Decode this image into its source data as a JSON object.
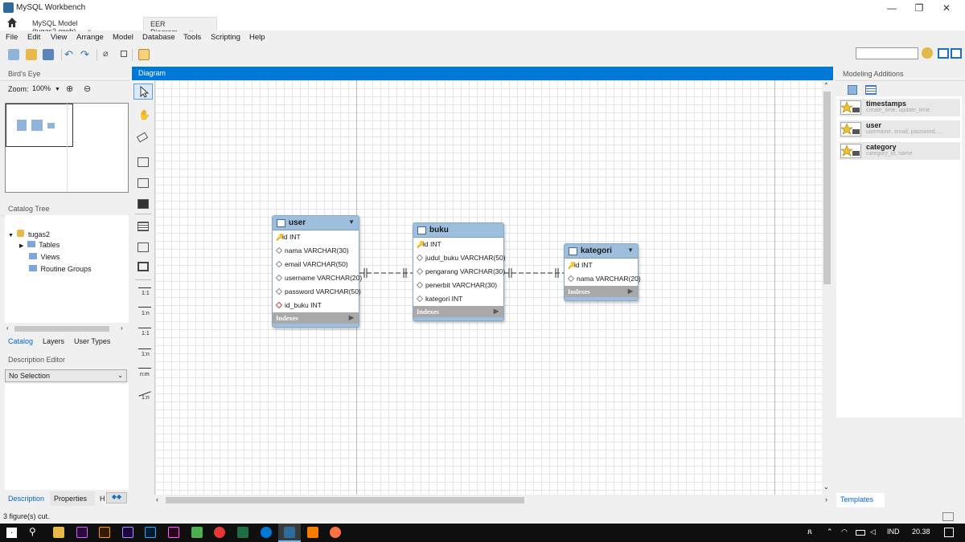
{
  "window": {
    "title": "MySQL Workbench",
    "controls": {
      "minimize": "—",
      "restore": "❐",
      "close": "✕"
    }
  },
  "tabs": [
    {
      "label": "MySQL Model (tugas2.mwb)",
      "close": "×"
    },
    {
      "label": "EER Diagram",
      "close": "×"
    }
  ],
  "menu": [
    "File",
    "Edit",
    "View",
    "Arrange",
    "Model",
    "Database",
    "Tools",
    "Scripting",
    "Help"
  ],
  "left": {
    "birdseye_title": "Bird's Eye",
    "zoom_label": "Zoom:",
    "zoom_value": "100%",
    "catalog_title": "Catalog Tree",
    "tree": {
      "root": "tugas2",
      "children": [
        "Tables",
        "Views",
        "Routine Groups"
      ]
    },
    "tabs": [
      "Catalog",
      "Layers",
      "User Types"
    ],
    "desc_title": "Description Editor",
    "desc_select": "No Selection",
    "bottom_tabs": [
      "Description",
      "Properties",
      "H"
    ]
  },
  "diagram": {
    "header": "Diagram",
    "entities": [
      {
        "name": "user",
        "columns": [
          {
            "text": "id INT",
            "kind": "pk"
          },
          {
            "text": "nama VARCHAR(30)",
            "kind": "col"
          },
          {
            "text": "email VARCHAR(50)",
            "kind": "col"
          },
          {
            "text": "username VARCHAR(20)",
            "kind": "col"
          },
          {
            "text": "password VARCHAR(50)",
            "kind": "col"
          },
          {
            "text": "id_buku INT",
            "kind": "fk"
          }
        ],
        "indexes": "Indexes"
      },
      {
        "name": "buku",
        "columns": [
          {
            "text": "id INT",
            "kind": "pk"
          },
          {
            "text": "judul_buku VARCHAR(50)",
            "kind": "col"
          },
          {
            "text": "pengarang VARCHAR(30)",
            "kind": "col"
          },
          {
            "text": "penerbit VARCHAR(30)",
            "kind": "col"
          },
          {
            "text": "kategori INT",
            "kind": "col"
          }
        ],
        "indexes": "Indexes"
      },
      {
        "name": "kategori",
        "columns": [
          {
            "text": "id INT",
            "kind": "pk"
          },
          {
            "text": "nama VARCHAR(20)",
            "kind": "col"
          }
        ],
        "indexes": "Indexes"
      }
    ]
  },
  "tools": {
    "labels": [
      "1:1",
      "1:n",
      "1:1",
      "1:n",
      "n:m",
      "1:n"
    ]
  },
  "right": {
    "title": "Modeling Additions",
    "templates": [
      {
        "name": "timestamps",
        "sub": "create_time, update_time"
      },
      {
        "name": "user",
        "sub": "username, email, password, ..."
      },
      {
        "name": "category",
        "sub": "category_id, name"
      }
    ],
    "bottom_tab": "Templates"
  },
  "status": "3 figure(s) cut.",
  "taskbar": {
    "lang": "IND",
    "time": "20.38"
  },
  "colors": {
    "accent": "#0078d7",
    "entity_header": "#9dbedd",
    "indexes_bar": "#a9a9a9"
  }
}
